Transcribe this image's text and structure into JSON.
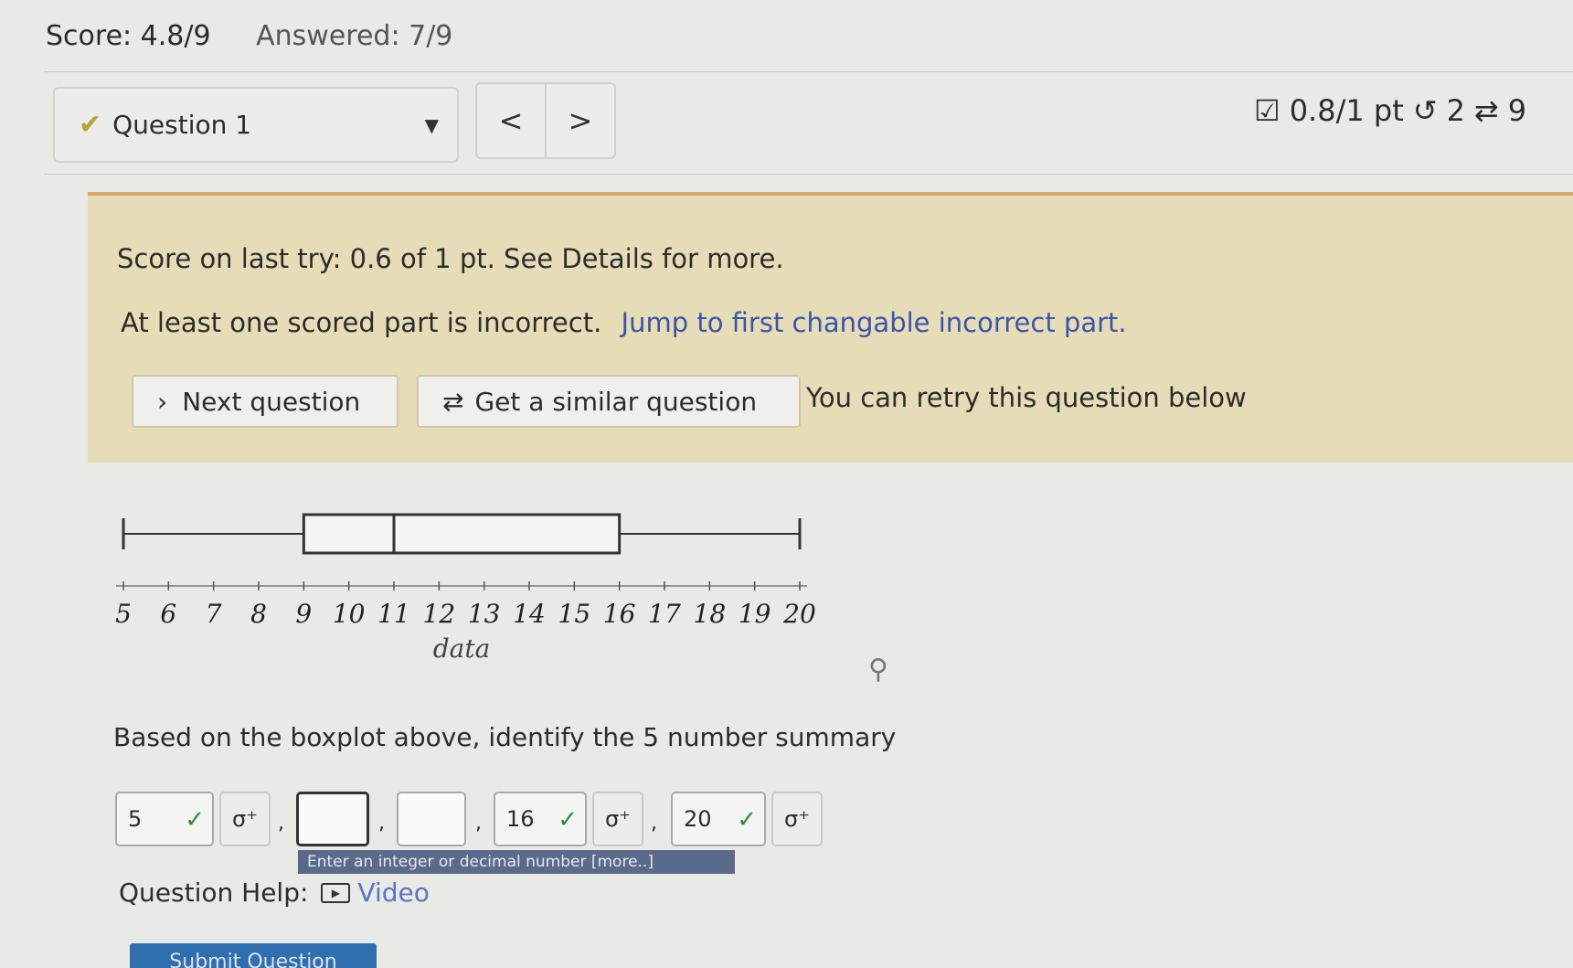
{
  "header": {
    "score": "Score: 4.8/9",
    "answered": "Answered: 7/9"
  },
  "question_nav": {
    "selected": "Question 1",
    "prev": "<",
    "next": ">",
    "points": "0.8/1 pt",
    "retries": "2",
    "attempts": "9"
  },
  "banner": {
    "last_try": "Score on last try: 0.6 of 1 pt. See Details for more.",
    "incorrect_text": "At least one scored part is incorrect.",
    "jump_link": "Jump to first changable incorrect part.",
    "next_question": "Next question",
    "similar_question": "Get a similar question",
    "retry_text": "You can retry this question below"
  },
  "chart_data": {
    "type": "boxplot",
    "xlabel": "data",
    "ticks": [
      5,
      6,
      7,
      8,
      9,
      10,
      11,
      12,
      13,
      14,
      15,
      16,
      17,
      18,
      19,
      20
    ],
    "xlim": [
      5,
      20
    ],
    "min": 5,
    "q1": 9,
    "median": 11,
    "q3": 16,
    "max": 20
  },
  "question": {
    "prompt": "Based on the boxplot above, identify the 5 number summary",
    "answers": [
      "5",
      "",
      "",
      "16",
      "20"
    ],
    "sigma_label": "σ⁺",
    "tooltip": "Enter an integer or decimal number [more..]"
  },
  "help": {
    "label": "Question Help:",
    "video": "Video"
  },
  "submit": "Submit Question",
  "colors": {
    "banner_bg": "#e6dcb7",
    "link": "#3a55a8",
    "correct": "#2c8a3c",
    "submit": "#2f6fb0"
  }
}
